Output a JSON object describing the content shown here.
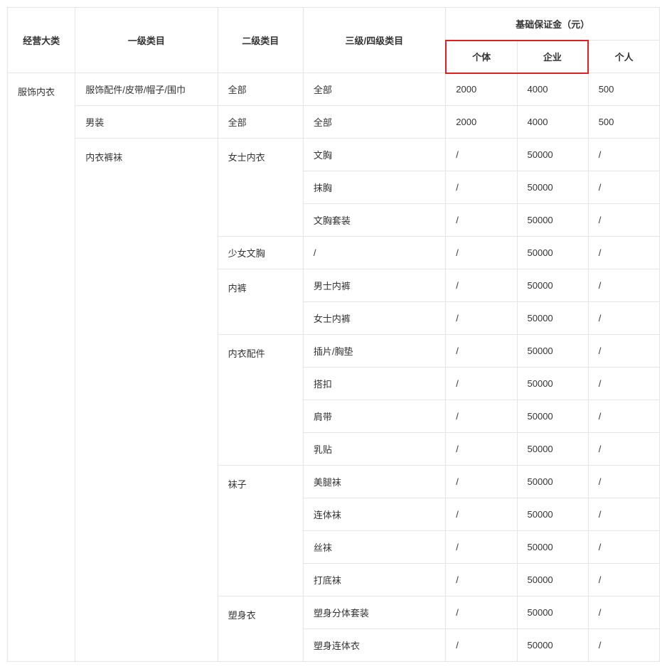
{
  "headers": {
    "col_major": "经营大类",
    "col_primary": "一级类目",
    "col_second": "二级类目",
    "col_third": "三级/四级类目",
    "deposit_group": "基础保证金（元）",
    "sub_p1": "个体",
    "sub_p2": "企业",
    "sub_p3": "个人"
  },
  "category_major": "服饰内衣",
  "rows": [
    {
      "primary": "服饰配件/皮带/帽子/围巾",
      "second": "全部",
      "third": "全部",
      "p1": "2000",
      "p2": "4000",
      "p3": "500"
    },
    {
      "primary": "男装",
      "second": "全部",
      "third": "全部",
      "p1": "2000",
      "p2": "4000",
      "p3": "500"
    },
    {
      "primary": "内衣裤袜",
      "second": "女士内衣",
      "third": "文胸",
      "p1": "/",
      "p2": "50000",
      "p3": "/"
    },
    {
      "third": "抹胸",
      "p1": "/",
      "p2": "50000",
      "p3": "/"
    },
    {
      "third": "文胸套装",
      "p1": "/",
      "p2": "50000",
      "p3": "/"
    },
    {
      "second": "少女文胸",
      "third": "/",
      "p1": "/",
      "p2": "50000",
      "p3": "/"
    },
    {
      "second": "内裤",
      "third": "男士内裤",
      "p1": "/",
      "p2": "50000",
      "p3": "/"
    },
    {
      "third": "女士内裤",
      "p1": "/",
      "p2": "50000",
      "p3": "/"
    },
    {
      "second": "内衣配件",
      "third": "插片/胸垫",
      "p1": "/",
      "p2": "50000",
      "p3": "/"
    },
    {
      "third": "搭扣",
      "p1": "/",
      "p2": "50000",
      "p3": "/"
    },
    {
      "third": "肩带",
      "p1": "/",
      "p2": "50000",
      "p3": "/"
    },
    {
      "third": "乳贴",
      "p1": "/",
      "p2": "50000",
      "p3": "/"
    },
    {
      "second": "袜子",
      "third": "美腿袜",
      "p1": "/",
      "p2": "50000",
      "p3": "/"
    },
    {
      "third": "连体袜",
      "p1": "/",
      "p2": "50000",
      "p3": "/"
    },
    {
      "third": "丝袜",
      "p1": "/",
      "p2": "50000",
      "p3": "/"
    },
    {
      "third": "打底袜",
      "p1": "/",
      "p2": "50000",
      "p3": "/"
    },
    {
      "second": "塑身衣",
      "third": "塑身分体套装",
      "p1": "/",
      "p2": "50000",
      "p3": "/"
    },
    {
      "third": "塑身连体衣",
      "p1": "/",
      "p2": "50000",
      "p3": "/"
    }
  ],
  "rowspans": {
    "major_span": 18,
    "primary_span_underwear": 16,
    "second_spans": {
      "女士内衣": 3,
      "内裤": 2,
      "内衣配件": 4,
      "袜子": 4,
      "塑身衣": 2
    }
  }
}
